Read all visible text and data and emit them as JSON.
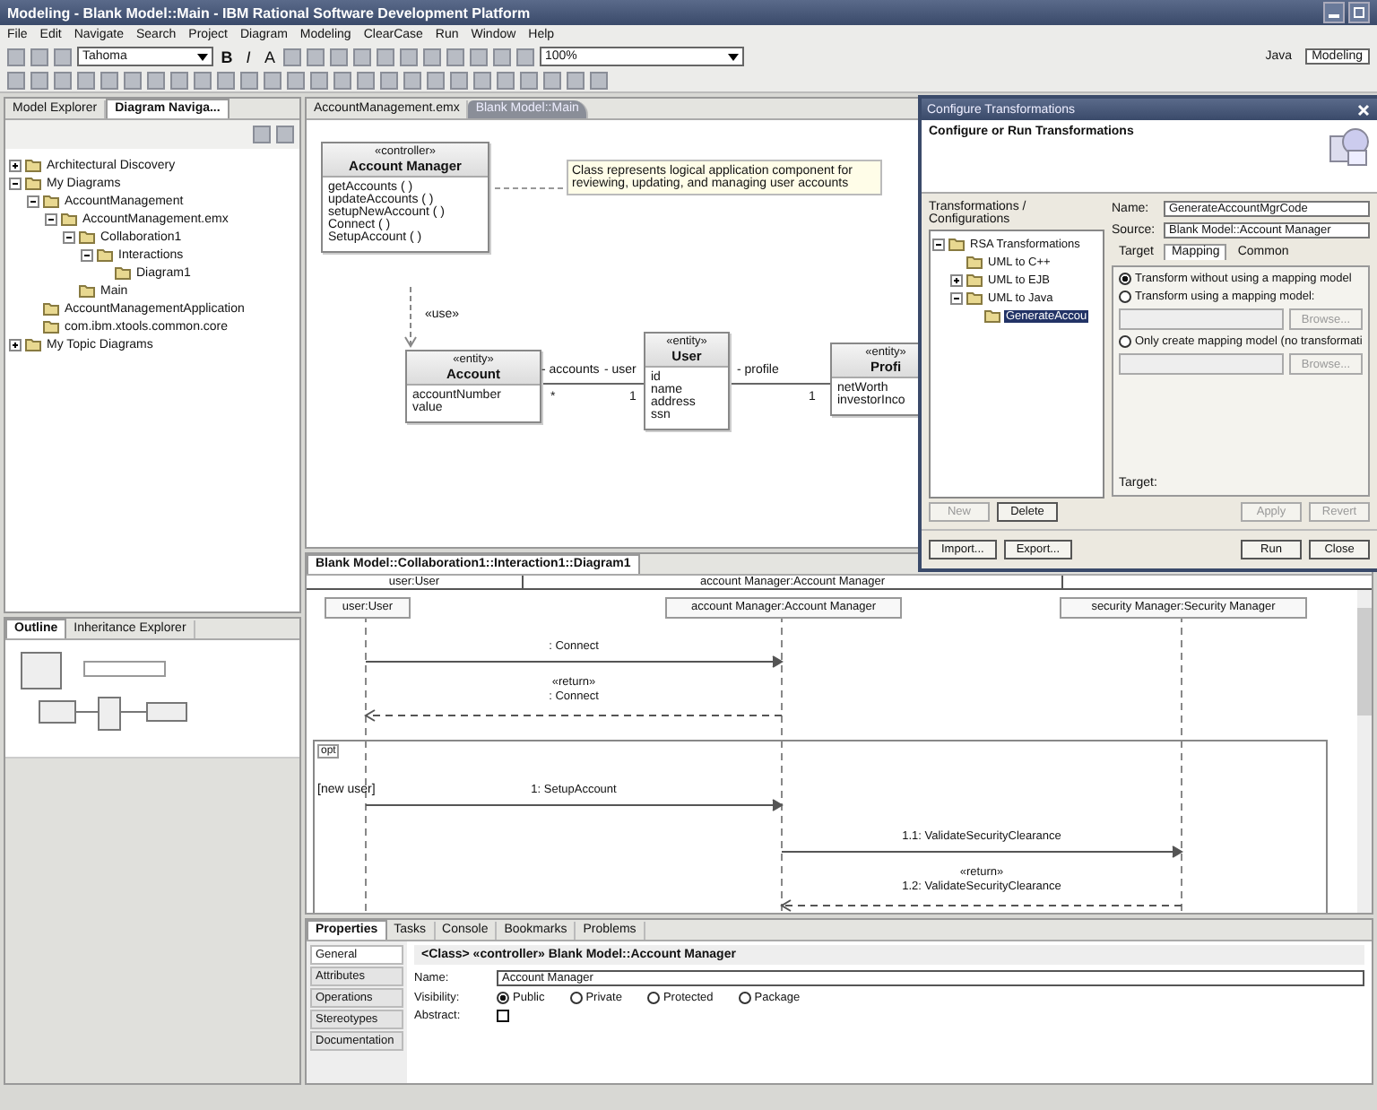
{
  "window": {
    "title": "Modeling - Blank Model::Main - IBM Rational Software Development Platform"
  },
  "menu": [
    "File",
    "Edit",
    "Navigate",
    "Search",
    "Project",
    "Diagram",
    "Modeling",
    "ClearCase",
    "Run",
    "Window",
    "Help"
  ],
  "toolbar": {
    "font": "Tahoma",
    "bold": "B",
    "italic": "I",
    "font_color": "A",
    "zoom": "100%"
  },
  "perspectives": [
    {
      "label": "Java",
      "selected": false
    },
    {
      "label": "Modeling",
      "selected": true
    }
  ],
  "left_tabs": [
    {
      "label": "Model Explorer",
      "selected": false
    },
    {
      "label": "Diagram Naviga...",
      "selected": true
    }
  ],
  "tree": [
    {
      "label": "Architectural Discovery",
      "expanded": false
    },
    {
      "label": "My Diagrams",
      "expanded": true,
      "children": [
        {
          "label": "AccountManagement",
          "expanded": true,
          "children": [
            {
              "label": "AccountManagement.emx",
              "expanded": true,
              "children": [
                {
                  "label": "Collaboration1",
                  "expanded": true,
                  "children": [
                    {
                      "label": "Interactions",
                      "expanded": true,
                      "children": [
                        {
                          "label": "Diagram1"
                        }
                      ]
                    }
                  ]
                },
                {
                  "label": "Main"
                }
              ]
            }
          ]
        },
        {
          "label": "AccountManagementApplication"
        },
        {
          "label": "com.ibm.xtools.common.core"
        }
      ]
    },
    {
      "label": "My Topic Diagrams",
      "expanded": false
    }
  ],
  "editor_tabs": [
    {
      "label": "AccountManagement.emx",
      "selected": false
    },
    {
      "label": "Blank Model::Main",
      "selected": true
    }
  ],
  "class_diagram": {
    "classes": [
      {
        "stereotype": "«controller»",
        "name": "Account Manager",
        "members": [
          "getAccounts ( )",
          "updateAccounts ( )",
          "setupNewAccount ( )",
          "Connect ( )",
          "SetupAccount ( )"
        ]
      },
      {
        "stereotype": "«entity»",
        "name": "Account",
        "members": [
          "accountNumber",
          "value"
        ]
      },
      {
        "stereotype": "«entity»",
        "name": "User",
        "members": [
          "id",
          "name",
          "address",
          "ssn"
        ]
      },
      {
        "stereotype": "«entity»",
        "name": "Profi",
        "members": [
          "netWorth",
          "investorInco"
        ]
      }
    ],
    "note": "Class represents logical application component for reviewing, updating, and managing user accounts",
    "labels": [
      "«use»",
      "- accounts",
      "*",
      "- user",
      "1",
      "- profile",
      "1"
    ]
  },
  "dialog": {
    "title": "Configure Transformations",
    "heading": "Configure or Run Transformations",
    "list_label": "Transformations / Configurations",
    "tree": [
      {
        "label": "RSA Transformations",
        "expanded": true,
        "selected": false,
        "children": [
          {
            "label": "UML to C++",
            "selected": false
          },
          {
            "label": "UML to EJB",
            "expanded": false,
            "selected": false
          },
          {
            "label": "UML to Java",
            "expanded": true,
            "selected": false,
            "children": [
              {
                "label": "GenerateAccou",
                "selected": true
              }
            ]
          }
        ]
      }
    ],
    "name_label": "Name:",
    "name": "GenerateAccountMgrCode",
    "source_label": "Source:",
    "source": "Blank Model::Account Manager",
    "tabs": [
      {
        "label": "Target",
        "selected": false
      },
      {
        "label": "Mapping",
        "selected": true
      },
      {
        "label": "Common",
        "selected": false
      }
    ],
    "options": [
      {
        "label": "Transform without using a mapping model",
        "selected": true
      },
      {
        "label": "Transform using a mapping model:",
        "selected": false,
        "browse": {
          "label": "Browse...",
          "disabled": true
        }
      },
      {
        "label": "Only create mapping model (no transformati",
        "selected": false,
        "browse": {
          "label": "Browse...",
          "disabled": true
        }
      }
    ],
    "target_label": "Target:",
    "list_buttons": [
      {
        "label": "New",
        "disabled": true
      },
      {
        "label": "Delete",
        "disabled": false
      }
    ],
    "edit_buttons": [
      {
        "label": "Apply",
        "disabled": true
      },
      {
        "label": "Revert",
        "disabled": true
      }
    ],
    "left_buttons": [
      {
        "label": "Import...",
        "disabled": false
      },
      {
        "label": "Export...",
        "disabled": false
      }
    ],
    "right_buttons": [
      {
        "label": "Run",
        "disabled": false
      },
      {
        "label": "Close",
        "disabled": false
      }
    ]
  },
  "sequence_editor": {
    "tab": "Blank Model::Collaboration1::Interaction1::Diagram1",
    "header": [
      "user:User",
      "account Manager:Account Manager"
    ],
    "lifelines": [
      "user:User",
      "account Manager:Account Manager",
      "security Manager:Security Manager"
    ],
    "messages": [
      {
        "kind": "call",
        "label": ": Connect"
      },
      {
        "kind": "return",
        "label": "«return»\n: Connect"
      },
      {
        "kind": "call",
        "label": "1: SetupAccount"
      },
      {
        "kind": "call",
        "label": "1.1: ValidateSecurityClearance"
      },
      {
        "kind": "return",
        "label": "«return»\n1.2: ValidateSecurityClearance"
      }
    ],
    "fragment": {
      "operator": "opt",
      "guard": "[new user]"
    }
  },
  "outline_tabs": [
    {
      "label": "Outline",
      "selected": true
    },
    {
      "label": "Inheritance Explorer",
      "selected": false
    }
  ],
  "bottom_tabs": [
    {
      "label": "Properties",
      "selected": true
    },
    {
      "label": "Tasks",
      "selected": false
    },
    {
      "label": "Console",
      "selected": false
    },
    {
      "label": "Bookmarks",
      "selected": false
    },
    {
      "label": "Problems",
      "selected": false
    }
  ],
  "properties": {
    "sections": [
      {
        "label": "General",
        "selected": true
      },
      {
        "label": "Attributes",
        "selected": false
      },
      {
        "label": "Operations",
        "selected": false
      },
      {
        "label": "Stereotypes",
        "selected": false
      },
      {
        "label": "Documentation",
        "selected": false
      }
    ],
    "header": "<Class> «controller» Blank Model::Account Manager",
    "name_label": "Name:",
    "name": "Account Manager",
    "visibility_label": "Visibility:",
    "visibility": [
      {
        "label": "Public",
        "selected": true
      },
      {
        "label": "Private",
        "selected": false
      },
      {
        "label": "Protected",
        "selected": false
      },
      {
        "label": "Package",
        "selected": false
      }
    ],
    "abstract_label": "Abstract:",
    "abstract": false
  }
}
